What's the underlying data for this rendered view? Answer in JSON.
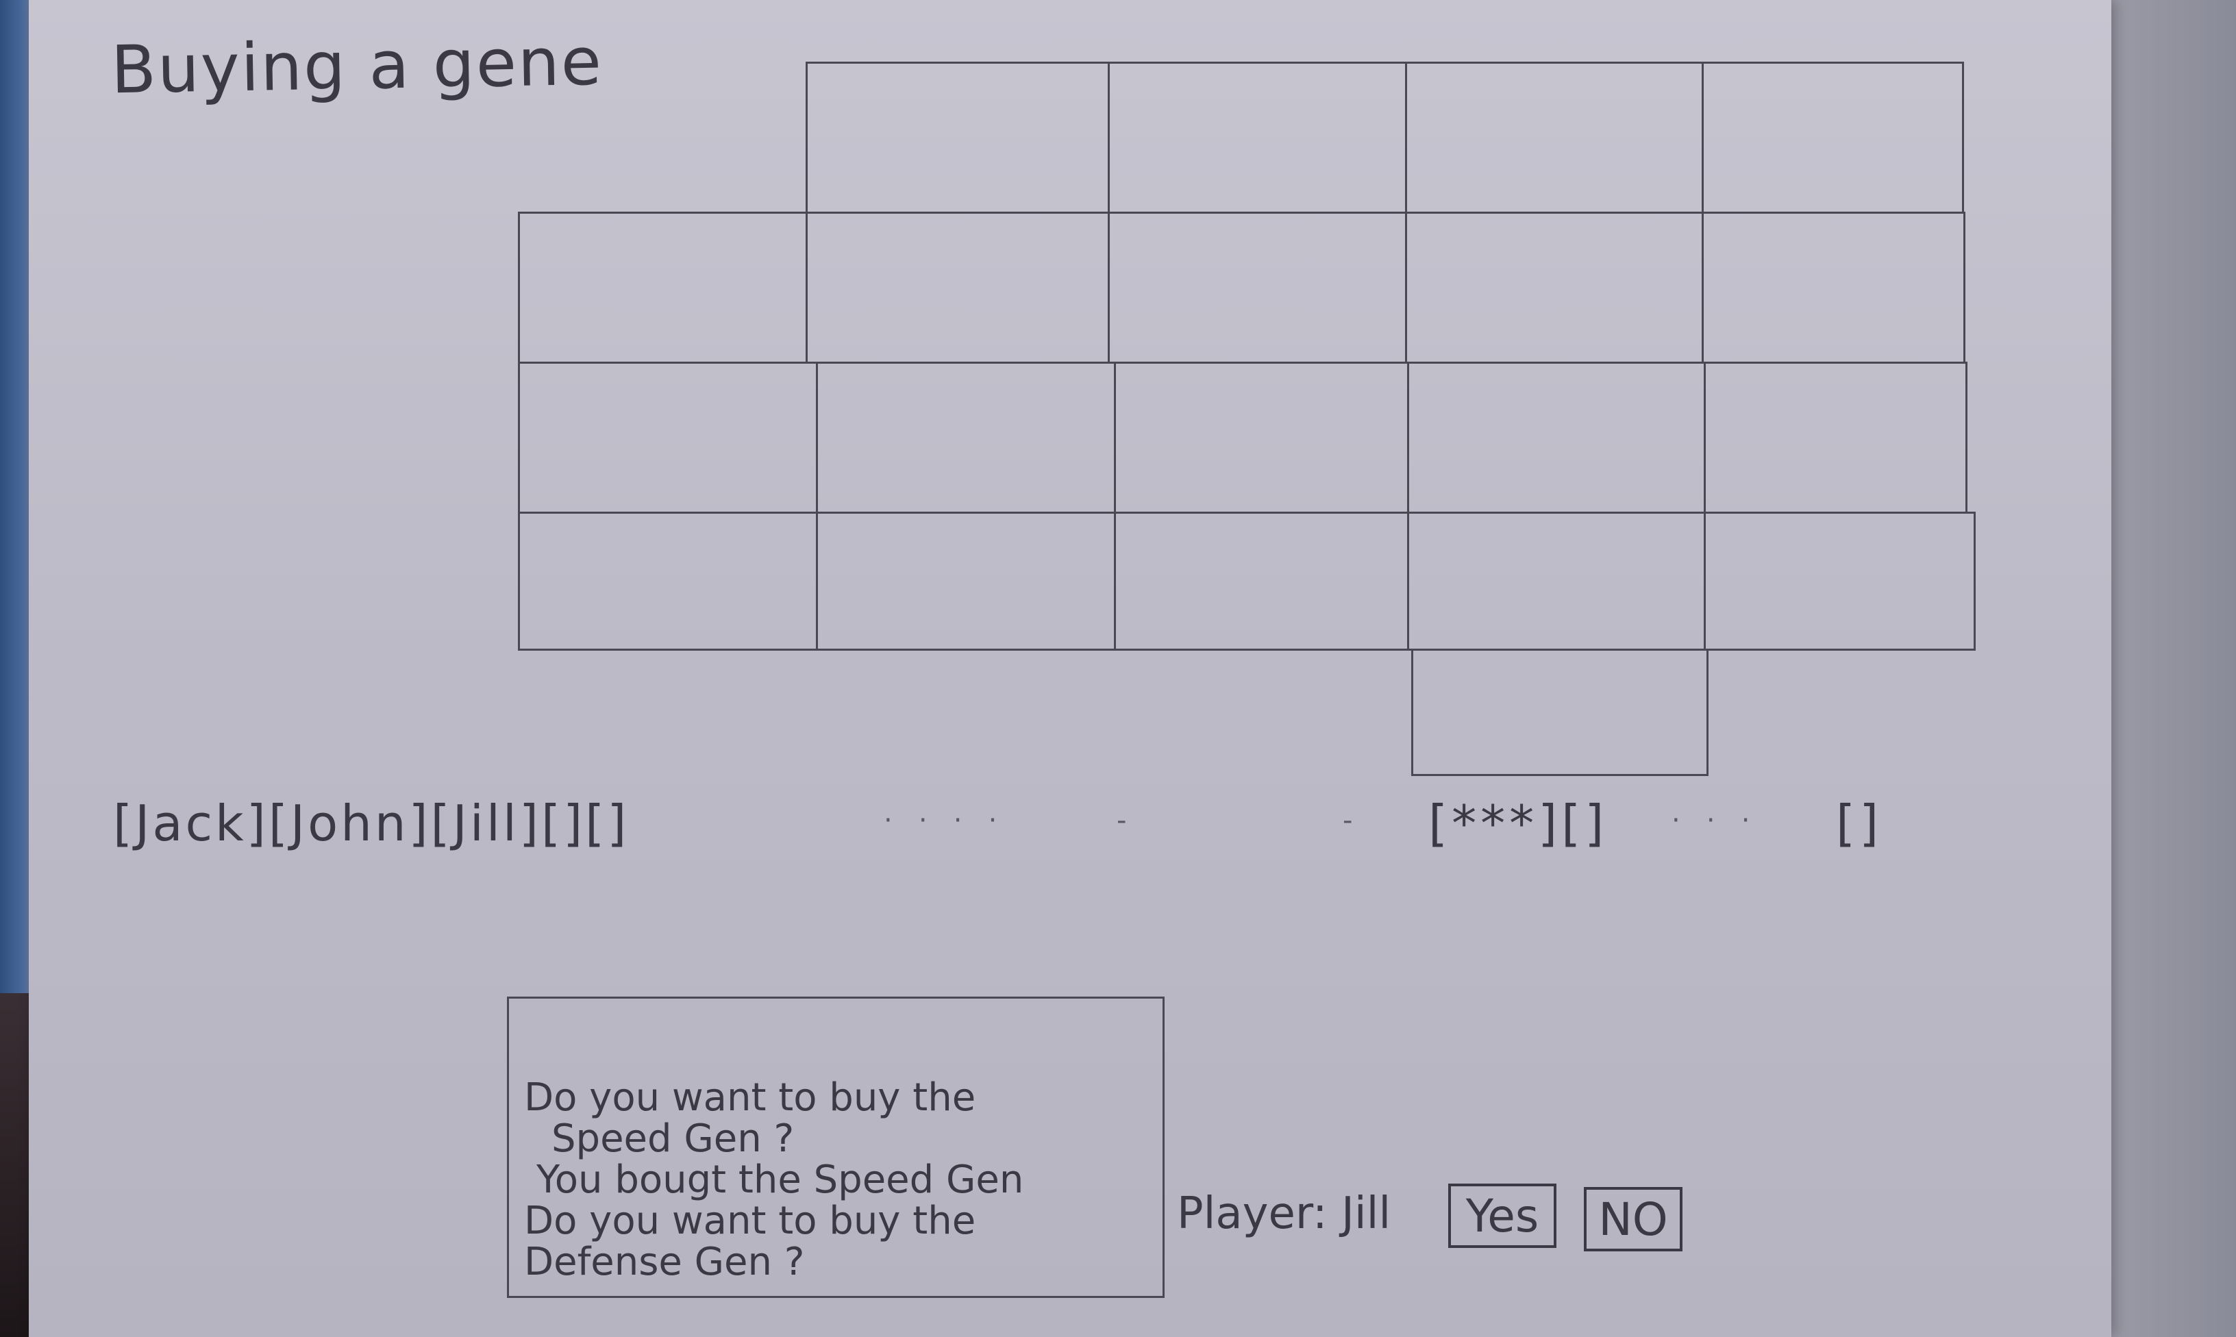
{
  "screen": {
    "title": "Buying a gene"
  },
  "board": {
    "cells": [
      {
        "id": "r0c1"
      },
      {
        "id": "r0c2"
      },
      {
        "id": "r0c3"
      },
      {
        "id": "r0c4"
      },
      {
        "id": "r1c0"
      },
      {
        "id": "r1c1"
      },
      {
        "id": "r1c2"
      },
      {
        "id": "r1c3"
      },
      {
        "id": "r1c4"
      },
      {
        "id": "r2c0"
      },
      {
        "id": "r2c1"
      },
      {
        "id": "r2c2"
      },
      {
        "id": "r2c3"
      },
      {
        "id": "r2c4"
      },
      {
        "id": "r3c0"
      },
      {
        "id": "r3c1"
      },
      {
        "id": "r3c2"
      },
      {
        "id": "r3c3"
      },
      {
        "id": "r3c4"
      },
      {
        "id": "r4c3"
      }
    ]
  },
  "players_bar": {
    "text": "[Jack][John][Jill][][]"
  },
  "genes_bar": {
    "owned_text": "[***][]",
    "extra_text": "[]"
  },
  "message_log": {
    "lines": [
      "Do you want to buy the",
      "Speed Gen ?",
      "You bougt the Speed Gen",
      "Do you want to buy the",
      "Defense Gen ?"
    ]
  },
  "prompt": {
    "player_label": "Player: Jill",
    "yes_label": "Yes",
    "no_label": "NO"
  }
}
